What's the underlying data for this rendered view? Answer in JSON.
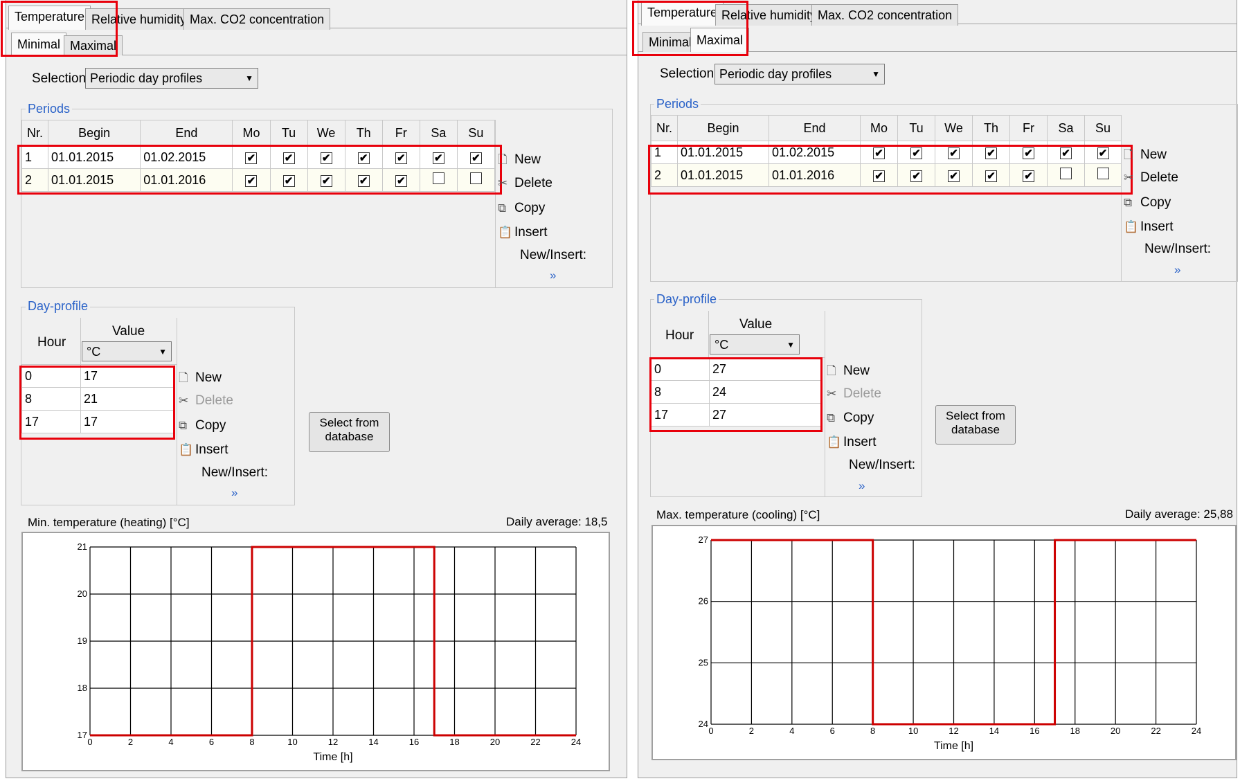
{
  "panels": [
    {
      "tabs": [
        "Temperature",
        "Relative humidity",
        "Max. CO2 concentration"
      ],
      "subtabs": [
        "Minimal",
        "Maximal"
      ],
      "active_subtab": "Minimal",
      "selection_label": "Selection",
      "selection_value": "Periodic day profiles",
      "periods_label": "Periods",
      "periods_columns": [
        "Nr.",
        "Begin",
        "End",
        "Mo",
        "Tu",
        "We",
        "Th",
        "Fr",
        "Sa",
        "Su"
      ],
      "periods_rows": [
        {
          "nr": "1",
          "begin": "01.01.2015",
          "end": "01.02.2015",
          "days": [
            true,
            true,
            true,
            true,
            true,
            true,
            true
          ]
        },
        {
          "nr": "2",
          "begin": "01.01.2015",
          "end": "01.01.2016",
          "days": [
            true,
            true,
            true,
            true,
            true,
            false,
            false
          ]
        }
      ],
      "period_commands": {
        "new": "New",
        "delete": "Delete",
        "copy": "Copy",
        "insert": "Insert",
        "new_insert": "New/Insert:",
        "more": "»"
      },
      "dayprofile_label": "Day-profile",
      "dayprofile_hour": "Hour",
      "dayprofile_value": "Value",
      "unit": "°C",
      "dayprofile_rows": [
        {
          "hour": "0",
          "value": "17"
        },
        {
          "hour": "8",
          "value": "21"
        },
        {
          "hour": "17",
          "value": "17"
        }
      ],
      "day_commands": {
        "new": "New",
        "delete": "Delete",
        "copy": "Copy",
        "insert": "Insert",
        "new_insert": "New/Insert:",
        "more": "»"
      },
      "select_db_button": "Select from database",
      "chart_title": "Min. temperature (heating) [°C]",
      "daily_average": "Daily average: 18,5"
    },
    {
      "tabs": [
        "Temperature",
        "Relative humidity",
        "Max. CO2 concentration"
      ],
      "subtabs": [
        "Minimal",
        "Maximal"
      ],
      "active_subtab": "Maximal",
      "selection_label": "Selection",
      "selection_value": "Periodic day profiles",
      "periods_label": "Periods",
      "periods_columns": [
        "Nr.",
        "Begin",
        "End",
        "Mo",
        "Tu",
        "We",
        "Th",
        "Fr",
        "Sa",
        "Su"
      ],
      "periods_rows": [
        {
          "nr": "1",
          "begin": "01.01.2015",
          "end": "01.02.2015",
          "days": [
            true,
            true,
            true,
            true,
            true,
            true,
            true
          ]
        },
        {
          "nr": "2",
          "begin": "01.01.2015",
          "end": "01.01.2016",
          "days": [
            true,
            true,
            true,
            true,
            true,
            false,
            false
          ]
        }
      ],
      "period_commands": {
        "new": "New",
        "delete": "Delete",
        "copy": "Copy",
        "insert": "Insert",
        "new_insert": "New/Insert:",
        "more": "»"
      },
      "dayprofile_label": "Day-profile",
      "dayprofile_hour": "Hour",
      "dayprofile_value": "Value",
      "unit": "°C",
      "dayprofile_rows": [
        {
          "hour": "0",
          "value": "27"
        },
        {
          "hour": "8",
          "value": "24"
        },
        {
          "hour": "17",
          "value": "27"
        }
      ],
      "day_commands": {
        "new": "New",
        "delete": "Delete",
        "copy": "Copy",
        "insert": "Insert",
        "new_insert": "New/Insert:",
        "more": "»"
      },
      "select_db_button": "Select from database",
      "chart_title": "Max. temperature (cooling) [°C]",
      "daily_average": "Daily average: 25,88"
    }
  ],
  "chart_data": [
    {
      "type": "line",
      "title": "Min. temperature (heating) [°C]",
      "xlabel": "Time [h]",
      "ylabel": "",
      "xlim": [
        0,
        24
      ],
      "ylim": [
        17,
        21
      ],
      "xticks": [
        0,
        2,
        4,
        6,
        8,
        10,
        12,
        14,
        16,
        18,
        20,
        22,
        24
      ],
      "yticks": [
        17,
        18,
        19,
        20,
        21
      ],
      "grid": true,
      "line_color": "#cc0000",
      "series": [
        {
          "x": [
            0,
            8,
            8,
            17,
            17,
            24
          ],
          "y": [
            17,
            17,
            21,
            21,
            17,
            17
          ]
        }
      ]
    },
    {
      "type": "line",
      "title": "Max. temperature (cooling) [°C]",
      "xlabel": "Time [h]",
      "ylabel": "",
      "xlim": [
        0,
        24
      ],
      "ylim": [
        24,
        27
      ],
      "xticks": [
        0,
        2,
        4,
        6,
        8,
        10,
        12,
        14,
        16,
        18,
        20,
        22,
        24
      ],
      "yticks": [
        24,
        25,
        26,
        27
      ],
      "grid": true,
      "line_color": "#cc0000",
      "series": [
        {
          "x": [
            0,
            8,
            8,
            17,
            17,
            24
          ],
          "y": [
            27,
            27,
            24,
            24,
            27,
            27
          ]
        }
      ]
    }
  ]
}
